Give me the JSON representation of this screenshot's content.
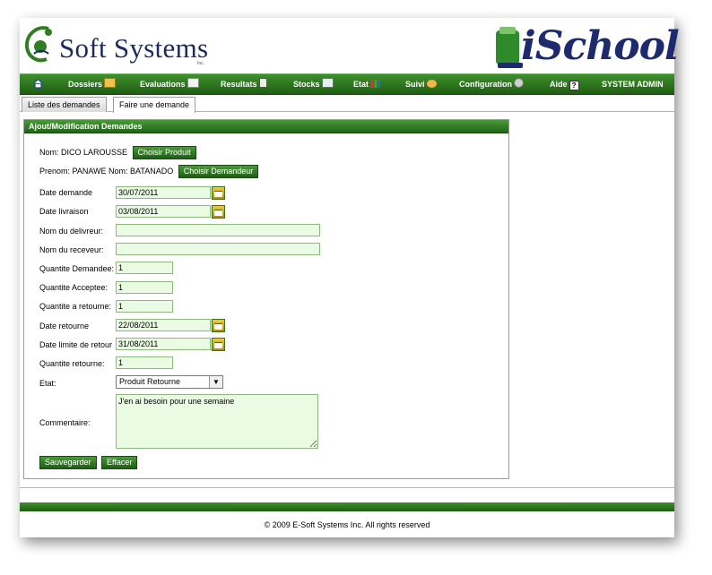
{
  "header": {
    "company_name": "Soft Systems",
    "company_suffix": "Inc.",
    "app_logo_text": "iSchool"
  },
  "nav": {
    "items": [
      {
        "label": "",
        "icon": "home-icon"
      },
      {
        "label": "Dossiers",
        "icon": "folder-icon"
      },
      {
        "label": "Evaluations",
        "icon": "pencil-icon"
      },
      {
        "label": "Resultats",
        "icon": "report-icon"
      },
      {
        "label": "Stocks",
        "icon": "envelope-icon"
      },
      {
        "label": "Etat",
        "icon": "chart-icon"
      },
      {
        "label": "Suivi",
        "icon": "users-icon"
      },
      {
        "label": "Configuration",
        "icon": "gear-icon"
      },
      {
        "label": "Aide",
        "icon": "help-icon"
      },
      {
        "label": "SYSTEM ADMIN",
        "icon": ""
      }
    ]
  },
  "tabs": [
    {
      "label": "Liste des demandes",
      "active": false
    },
    {
      "label": "Faire une demande",
      "active": true
    }
  ],
  "form": {
    "title": "Ajout/Modification Demandes",
    "nom_text": "Nom: DICO LAROUSSE",
    "choisir_produit": "Choisir Produit",
    "prenom_text": "Prenom: PANAWE Nom: BATANADO",
    "choisir_demandeur": "Choisir Demandeur",
    "date_demande_label": "Date demande",
    "date_demande_value": "30/07/2011",
    "date_livraison_label": "Date livraison",
    "date_livraison_value": "03/08/2011",
    "delivreur_label": "Nom du delivreur:",
    "delivreur_value": "",
    "receveur_label": "Nom du receveur:",
    "receveur_value": "",
    "qte_demandee_label": "Quantite Demandee:",
    "qte_demandee_value": "1",
    "qte_acceptee_label": "Quantite Acceptee:",
    "qte_acceptee_value": "1",
    "qte_a_retourne_label": "Quantite a retourne:",
    "qte_a_retourne_value": "1",
    "date_retourne_label": "Date retourne",
    "date_retourne_value": "22/08/2011",
    "date_limite_label": "Date limite de retour",
    "date_limite_value": "31/08/2011",
    "qte_retourne_label": "Quantite retourne:",
    "qte_retourne_value": "1",
    "etat_label": "Etat:",
    "etat_value": "Produit Retourne",
    "commentaire_label": "Commentaire:",
    "commentaire_value": "J'en ai besoin pour une semaine",
    "save_label": "Sauvegarder",
    "clear_label": "Effacer"
  },
  "footer": {
    "copyright": "© 2009 E-Soft Systems Inc. All rights reserved"
  },
  "colors": {
    "nav_green": "#2f7a20",
    "input_bg": "#eafbe4",
    "logo_blue": "#1d2a5e"
  }
}
